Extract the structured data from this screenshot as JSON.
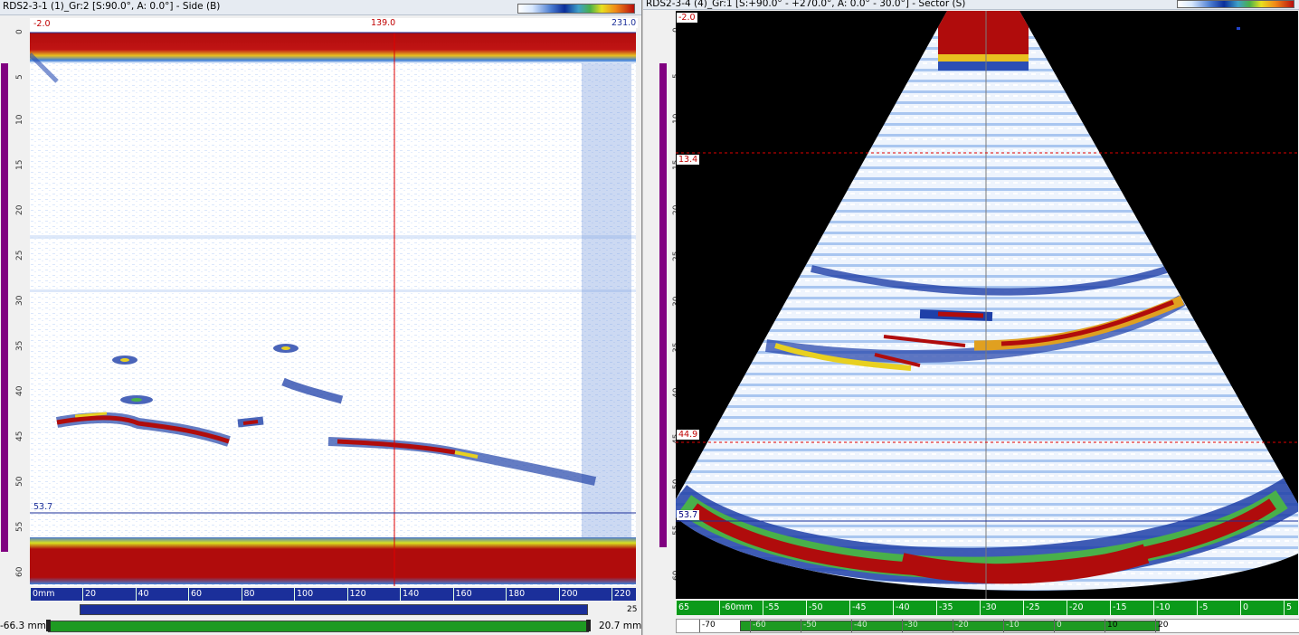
{
  "left_view": {
    "title": "RDS2-3-1 (1)_Gr:2 [S:90.0°, A: 0.0°] - Side (B)",
    "cursor_left": "-2.0",
    "cursor_x": "139.0",
    "cursor_right": "231.0",
    "gate_depth": "53.7",
    "y_ticks": [
      "0",
      "5",
      "10",
      "15",
      "20",
      "25",
      "30",
      "35",
      "40",
      "45",
      "50",
      "55",
      "60"
    ],
    "x_ticks": [
      "0mm",
      "20",
      "40",
      "60",
      "80",
      "100",
      "120",
      "140",
      "160",
      "180",
      "200",
      "220"
    ],
    "x_unit_end": "25",
    "scroll_labels": [
      "-66.3 mm",
      "20.7 mm"
    ]
  },
  "right_view": {
    "title": "RDS2-3-4 (4)_Gr:1 [S:+90.0° - +270.0°, A: 0.0° - 30.0°] - Sector (S)",
    "cursor_top": "-2.0",
    "gate_a": "13.4",
    "gate_b": "44.9",
    "gate_c": "53.7",
    "y_ticks": [
      "0",
      "5",
      "10",
      "15",
      "20",
      "25",
      "30",
      "35",
      "40",
      "45",
      "50",
      "55",
      "60"
    ],
    "x_ticks": [
      "65",
      "-60mm",
      "-55",
      "-50",
      "-45",
      "-40",
      "-35",
      "-30",
      "-25",
      "-20",
      "-15",
      "-10",
      "-5",
      "0",
      "5"
    ],
    "scroll_ticks": [
      "-70",
      "-60",
      "-50",
      "-40",
      "-30",
      "-20",
      "-10",
      "0",
      "10",
      "20"
    ]
  },
  "colors": {
    "saturation_red": "#b00c0c",
    "background_white": "#ffffff",
    "noise_blue": "#3d6fcf",
    "cursor_red": "#e00000",
    "ruler_purple": "#800080",
    "ruler_green": "#0b9a1a"
  }
}
